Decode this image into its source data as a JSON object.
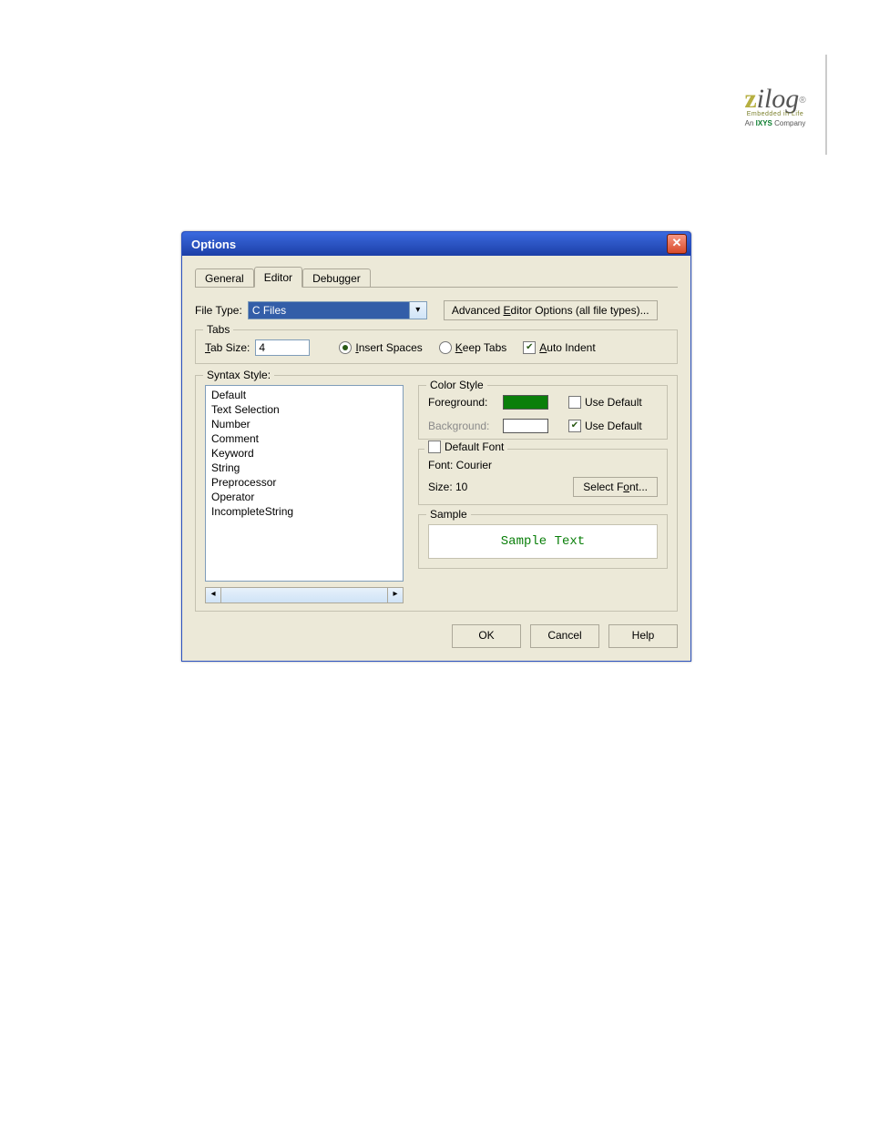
{
  "logo": {
    "brand_z": "z",
    "brand_ilog": "ilog",
    "tagline": "Embedded in Life",
    "subline_prefix": "An ",
    "subline_ixys": "IXYS",
    "subline_suffix": " Company"
  },
  "dialog": {
    "title": "Options",
    "tabs": {
      "general": "General",
      "editor": "Editor",
      "debugger": "Debugger"
    },
    "file_type_label": "File Type:",
    "file_type_value": "C Files",
    "advanced_btn": "Advanced Editor Options (all file types)...",
    "tabs_group": {
      "title": "Tabs",
      "tab_size_label": "Tab Size:",
      "tab_size_value": "4",
      "insert_spaces": "Insert Spaces",
      "keep_tabs": "Keep Tabs",
      "auto_indent": "Auto Indent"
    },
    "syntax": {
      "title": "Syntax Style:",
      "items": [
        "Default",
        "Text Selection",
        "Number",
        "Comment",
        "Keyword",
        "String",
        "Preprocessor",
        "Operator",
        "IncompleteString"
      ]
    },
    "color_style": {
      "title": "Color Style",
      "foreground_label": "Foreground:",
      "background_label": "Background:",
      "use_default": "Use Default",
      "fg_color": "#0a7f0a",
      "bg_color": "#ffffff"
    },
    "font_box": {
      "default_font_label": "Default Font",
      "font_label": "Font: Courier",
      "size_label": "Size: 10",
      "select_font_btn": "Select Font..."
    },
    "sample": {
      "title": "Sample",
      "text": "Sample Text"
    },
    "buttons": {
      "ok": "OK",
      "cancel": "Cancel",
      "help": "Help"
    }
  }
}
